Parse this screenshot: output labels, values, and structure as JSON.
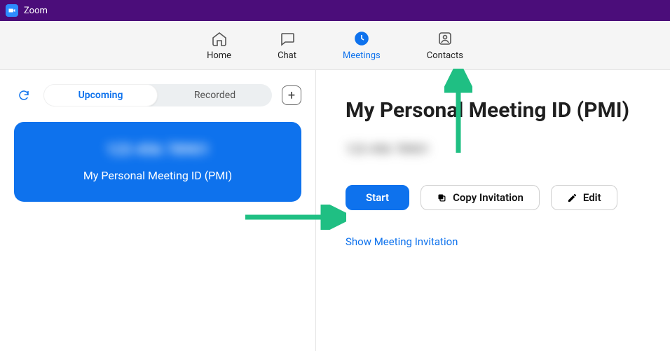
{
  "app": {
    "title": "Zoom"
  },
  "nav": {
    "home": "Home",
    "chat": "Chat",
    "meetings": "Meetings",
    "contacts": "Contacts",
    "active": "meetings"
  },
  "sidebar": {
    "tabs": {
      "upcoming": "Upcoming",
      "recorded": "Recorded",
      "active": "upcoming"
    },
    "card": {
      "id": "123 456 78901",
      "label": "My Personal Meeting ID (PMI)"
    }
  },
  "main": {
    "title": "My Personal Meeting ID (PMI)",
    "meeting_id": "123 456 78901",
    "start": "Start",
    "copy": "Copy Invitation",
    "edit": "Edit",
    "show_invitation": "Show Meeting Invitation"
  }
}
